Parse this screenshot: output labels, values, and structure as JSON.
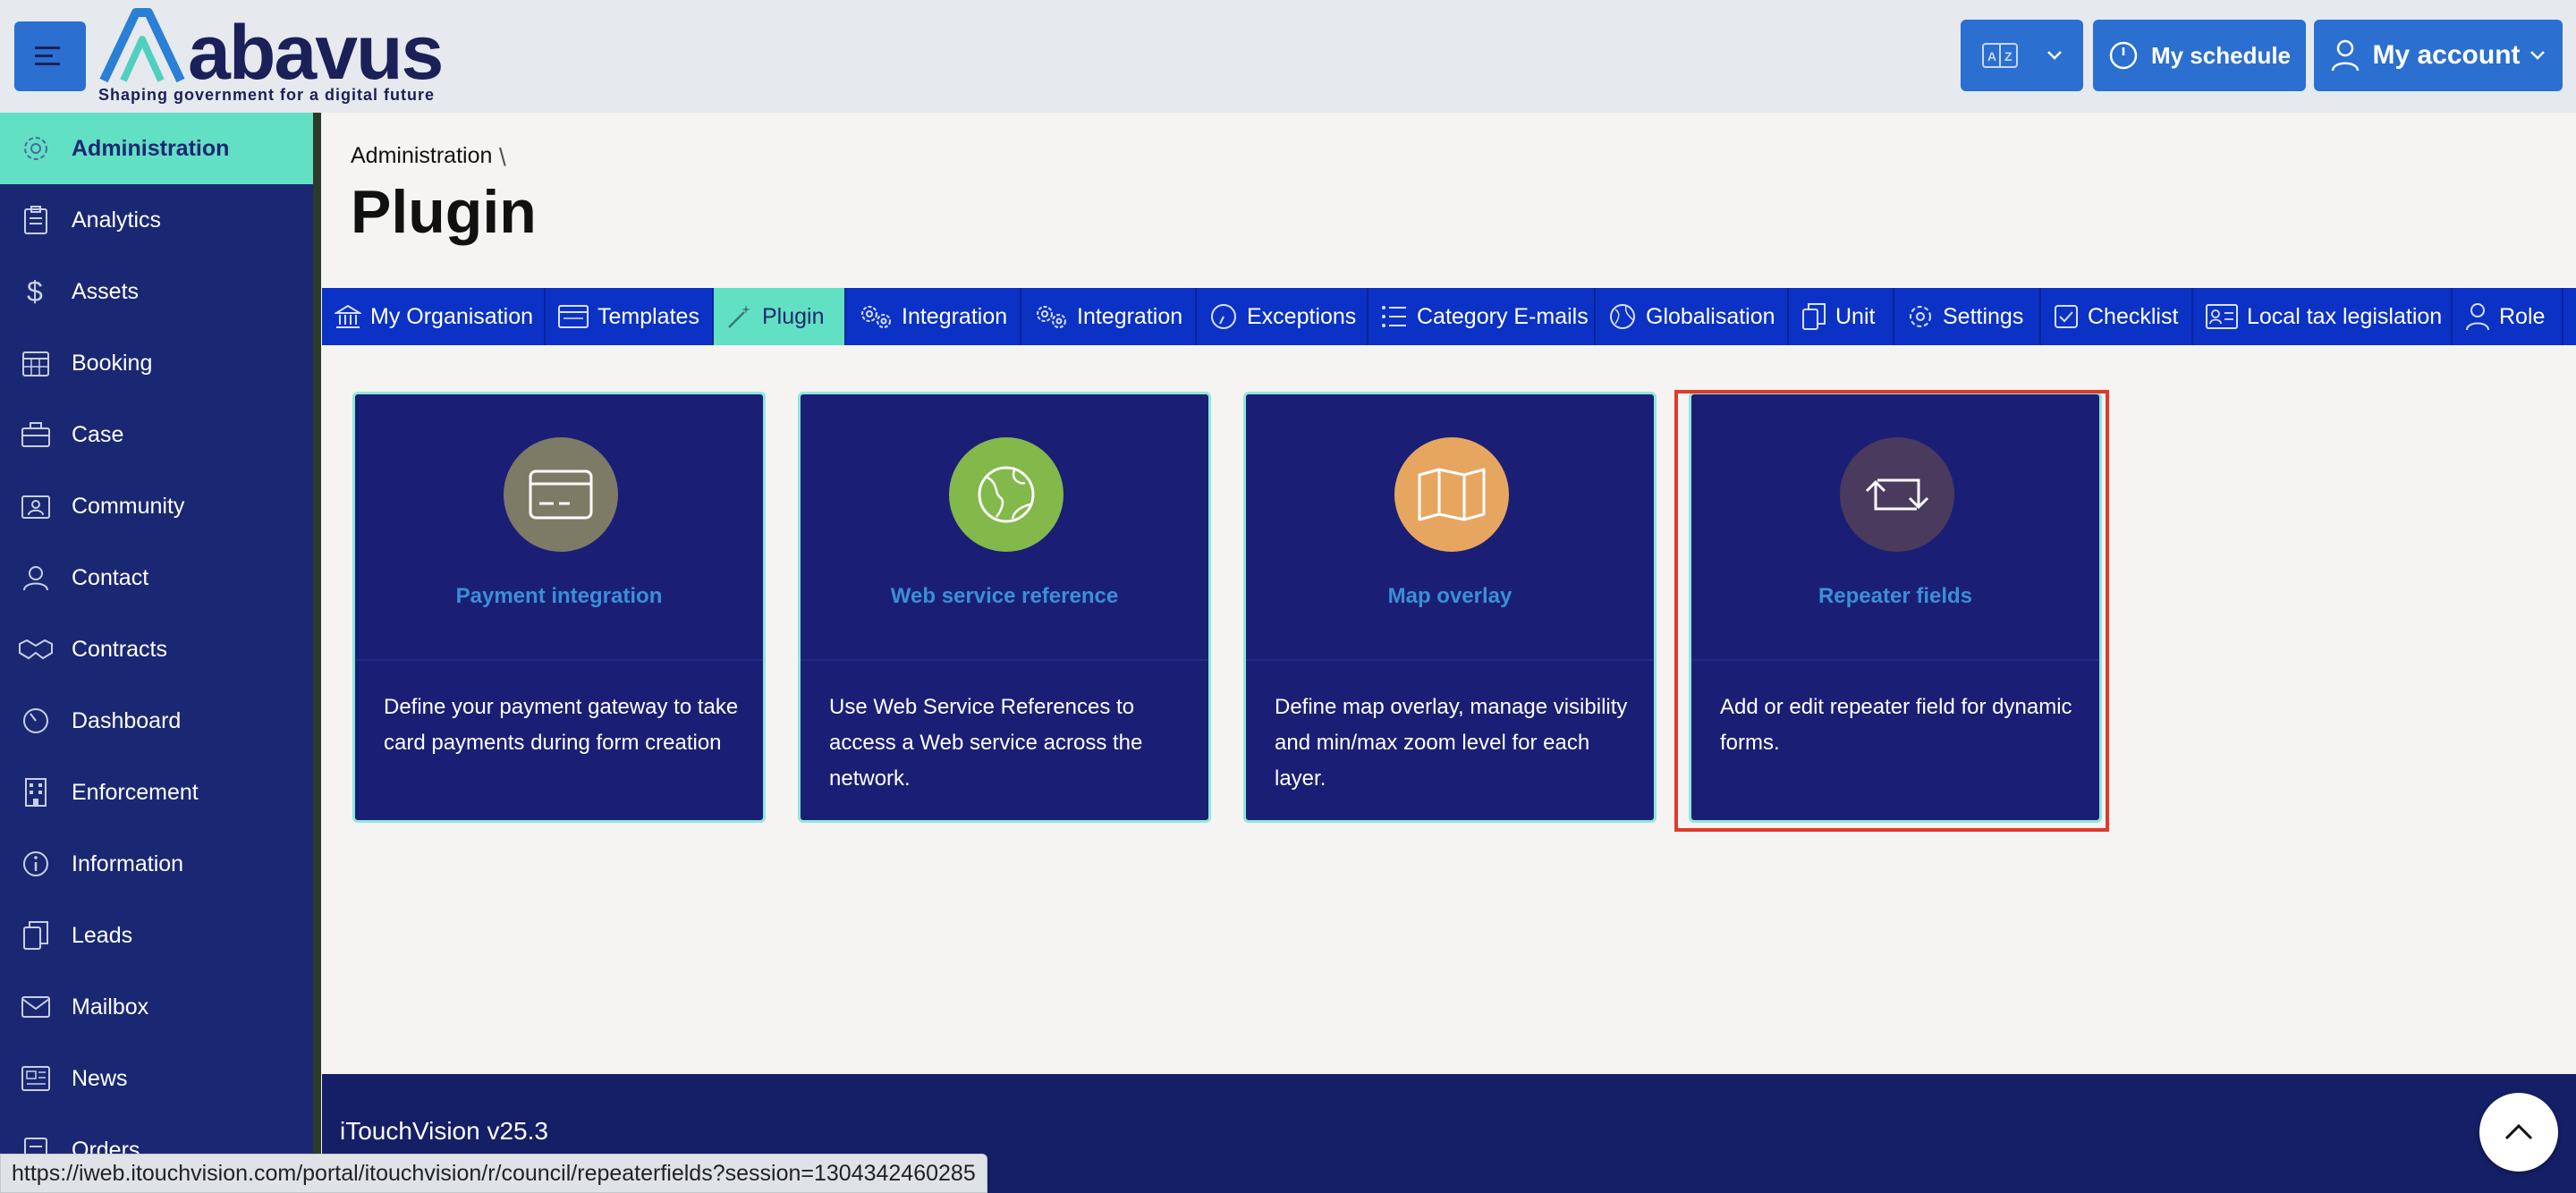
{
  "header": {
    "logo_text": "abavus",
    "logo_tagline": "Shaping government for a digital future",
    "schedule_label": "My schedule",
    "account_label": "My account"
  },
  "sidebar": {
    "items": [
      {
        "label": "Administration",
        "icon": "gear-icon",
        "active": true
      },
      {
        "label": "Analytics",
        "icon": "clipboard-icon"
      },
      {
        "label": "Assets",
        "icon": "dollar-icon"
      },
      {
        "label": "Booking",
        "icon": "calendar-icon"
      },
      {
        "label": "Case",
        "icon": "briefcase-icon"
      },
      {
        "label": "Community",
        "icon": "community-icon"
      },
      {
        "label": "Contact",
        "icon": "contact-icon"
      },
      {
        "label": "Contracts",
        "icon": "handshake-icon"
      },
      {
        "label": "Dashboard",
        "icon": "gauge-icon"
      },
      {
        "label": "Enforcement",
        "icon": "building-icon"
      },
      {
        "label": "Information",
        "icon": "info-icon"
      },
      {
        "label": "Leads",
        "icon": "leads-icon"
      },
      {
        "label": "Mailbox",
        "icon": "mail-icon"
      },
      {
        "label": "News",
        "icon": "newspaper-icon"
      },
      {
        "label": "Orders",
        "icon": "orders-icon"
      }
    ]
  },
  "breadcrumb": {
    "root": "Administration",
    "separator": "\\"
  },
  "page": {
    "title": "Plugin"
  },
  "tabs": [
    {
      "label": "My Organisation"
    },
    {
      "label": "Templates"
    },
    {
      "label": "Plugin",
      "active": true
    },
    {
      "label": "Integration"
    },
    {
      "label": "Integration"
    },
    {
      "label": "Exceptions"
    },
    {
      "label": "Category E-mails"
    },
    {
      "label": "Globalisation"
    },
    {
      "label": "Unit"
    },
    {
      "label": "Settings"
    },
    {
      "label": "Checklist"
    },
    {
      "label": "Local tax legislation"
    },
    {
      "label": "Role"
    }
  ],
  "cards": [
    {
      "title": "Payment integration",
      "description": "Define your payment gateway to take card payments during form creation",
      "icon": "credit-card-icon",
      "circle_color": "#7d7a66"
    },
    {
      "title": "Web service reference",
      "description": "Use Web Service References to access a Web service across the network.",
      "icon": "globe-icon",
      "circle_color": "#83b84a"
    },
    {
      "title": "Map overlay",
      "description": "Define map overlay, manage visibility and min/max zoom level for each layer.",
      "icon": "map-icon",
      "circle_color": "#e7a660"
    },
    {
      "title": "Repeater fields",
      "description": "Add or edit repeater field for dynamic forms.",
      "icon": "repeat-icon",
      "circle_color": "#4a3a5e"
    }
  ],
  "footer": {
    "version": "iTouchVision v25.3"
  },
  "statusbar": {
    "url": "https://iweb.itouchvision.com/portal/itouchvision/r/council/repeaterfields?session=1304342460285"
  },
  "colors": {
    "brand_blue": "#2b6fd0",
    "sidebar_bg": "#1a2873",
    "accent_teal": "#62e0c4",
    "tab_blue": "#0b32c5",
    "card_bg": "#1a1f75",
    "highlight_red": "#e03a2a"
  }
}
